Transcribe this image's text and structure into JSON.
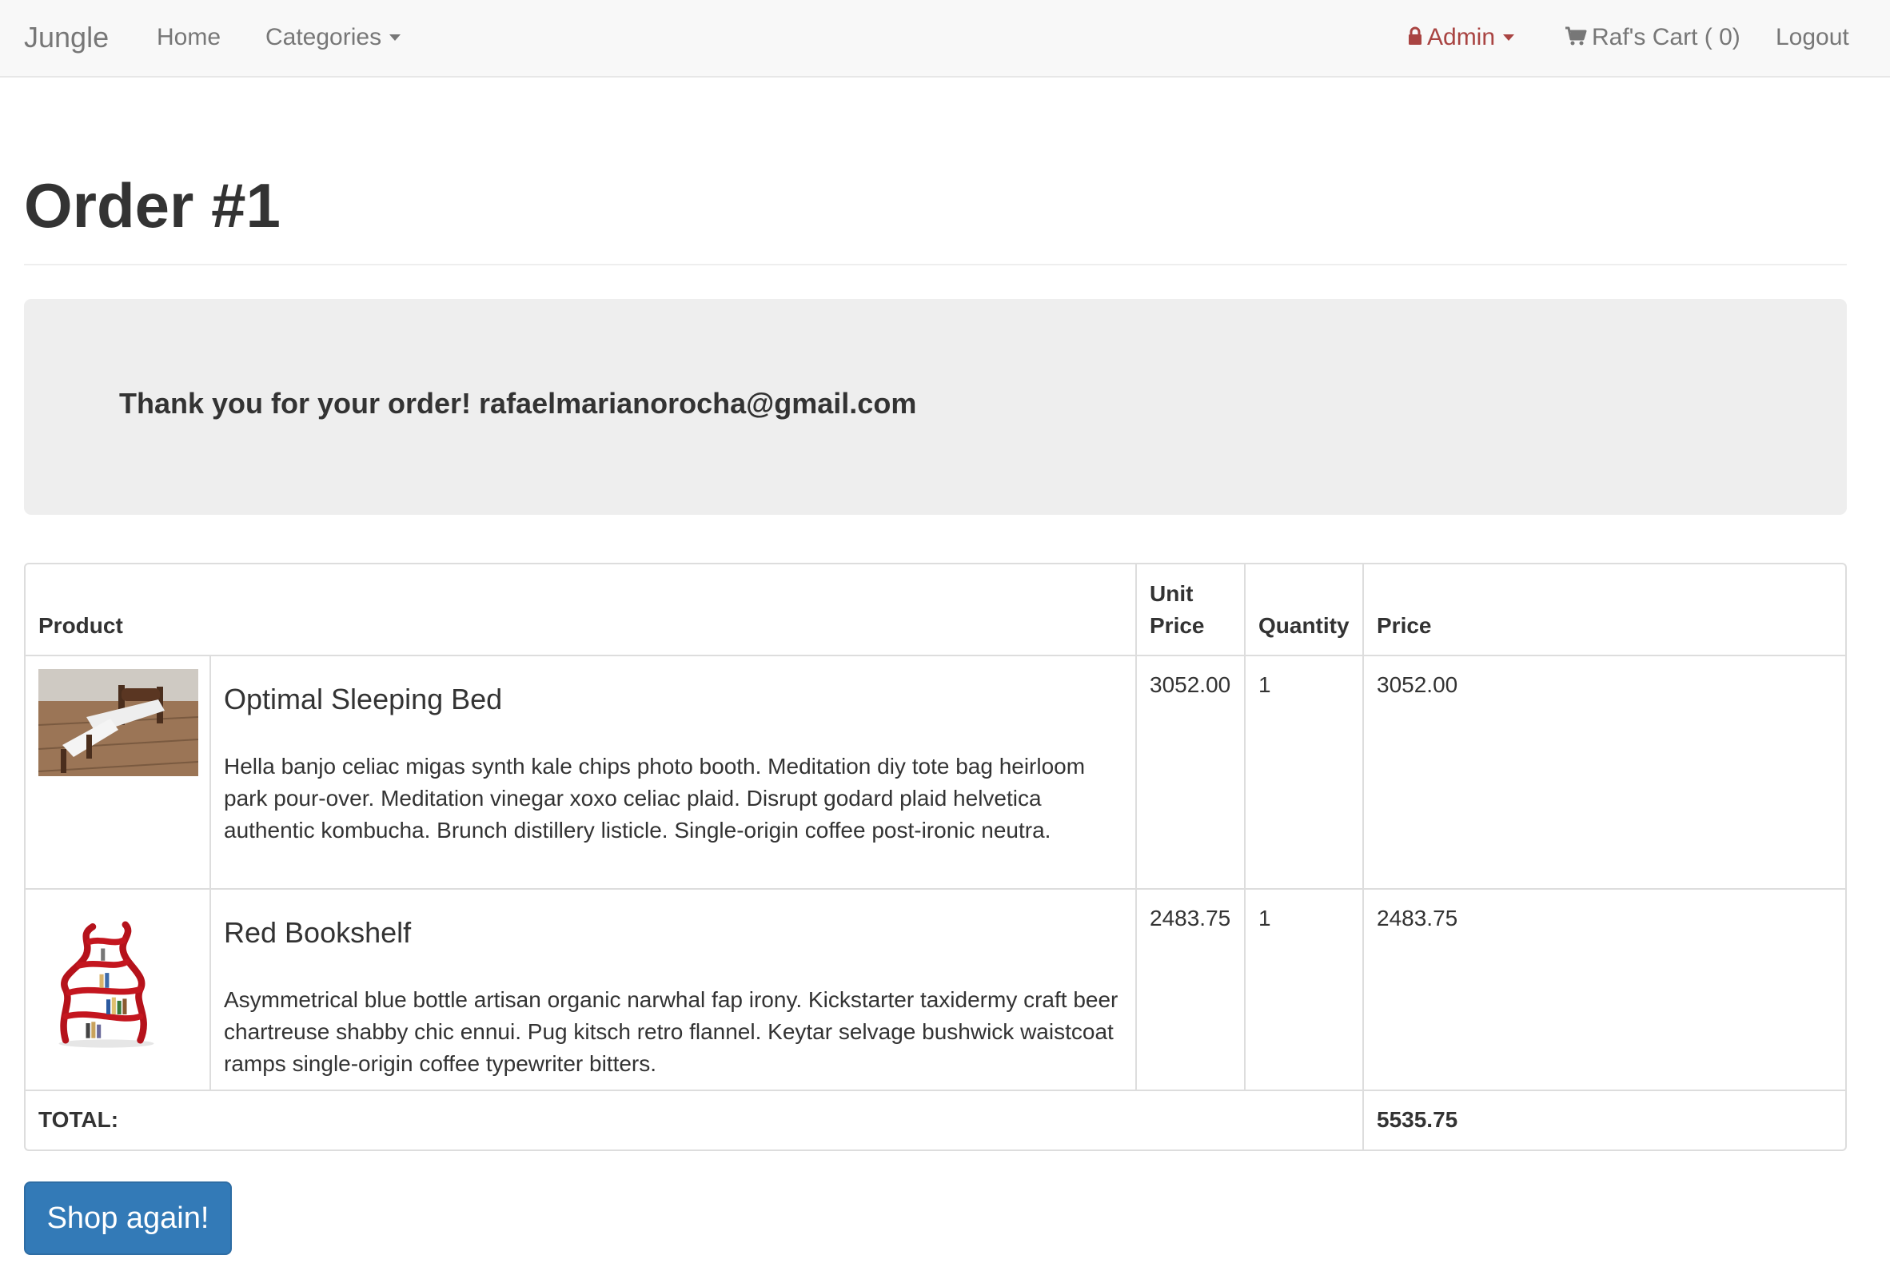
{
  "navbar": {
    "brand": "Jungle",
    "home": "Home",
    "categories": "Categories",
    "admin": "Admin",
    "cart": "Raf's Cart ( 0)",
    "logout": "Logout"
  },
  "page": {
    "title": "Order #1",
    "thanks_message": "Thank you for your order! rafaelmarianorocha@gmail.com"
  },
  "table": {
    "headers": {
      "product": "Product",
      "unit_price_line1": "Unit",
      "unit_price_line2": "Price",
      "quantity": "Quantity",
      "price": "Price"
    },
    "items": [
      {
        "name": "Optimal Sleeping Bed",
        "description": "Hella banjo celiac migas synth kale chips photo booth. Meditation diy tote bag heirloom park pour-over. Meditation vinegar xoxo celiac plaid. Disrupt godard plaid helvetica authentic kombucha. Brunch distillery listicle. Single-origin coffee post-ironic neutra.",
        "unit_price": "3052.00",
        "quantity": "1",
        "price": "3052.00"
      },
      {
        "name": "Red Bookshelf",
        "description": "Asymmetrical blue bottle artisan organic narwhal fap irony. Kickstarter taxidermy craft beer chartreuse shabby chic ennui. Pug kitsch retro flannel. Keytar selvage bushwick waistcoat ramps single-origin coffee typewriter bitters.",
        "unit_price": "2483.75",
        "quantity": "1",
        "price": "2483.75"
      }
    ],
    "total_label": "TOTAL:",
    "total_value": "5535.75"
  },
  "actions": {
    "shop_again": "Shop again!"
  },
  "colors": {
    "navbar_bg": "#f8f8f8",
    "admin_red": "#a94442",
    "button_blue": "#337ab7",
    "jumbotron_bg": "#eeeeee"
  },
  "icons": {
    "admin": "lock-icon",
    "cart": "shopping-cart-icon"
  }
}
